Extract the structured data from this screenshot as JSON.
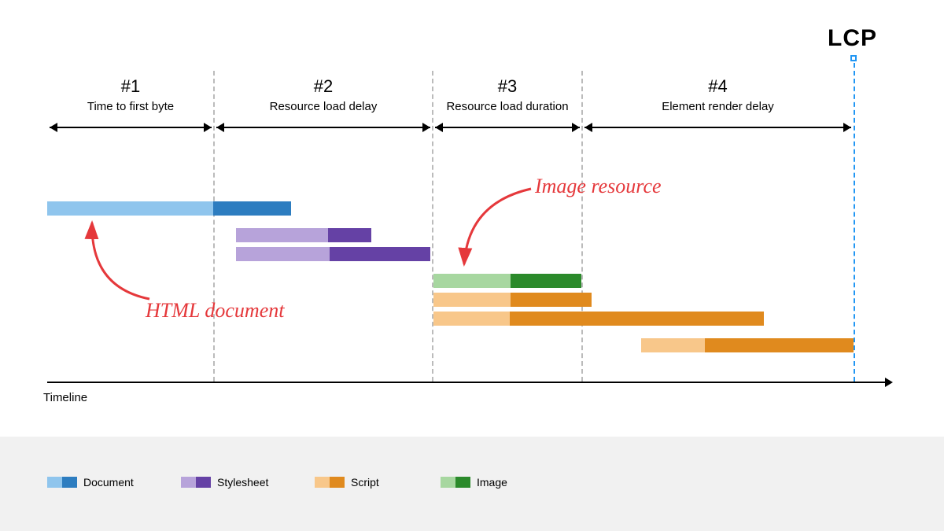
{
  "lcp_label": "LCP",
  "phases": [
    {
      "num": "#1",
      "title": "Time to first byte"
    },
    {
      "num": "#2",
      "title": "Resource load delay"
    },
    {
      "num": "#3",
      "title": "Resource load duration"
    },
    {
      "num": "#4",
      "title": "Element render delay"
    }
  ],
  "axis_label": "Timeline",
  "annotations": {
    "html_doc": "HTML document",
    "image_res": "Image resource"
  },
  "legend": [
    {
      "label": "Document",
      "light": "#8fc5ed",
      "dark": "#2d7dc0"
    },
    {
      "label": "Stylesheet",
      "light": "#b7a3da",
      "dark": "#6541a5"
    },
    {
      "label": "Script",
      "light": "#f8c78a",
      "dark": "#e08a1e"
    },
    {
      "label": "Image",
      "light": "#a7d7a0",
      "dark": "#2b8a2b"
    }
  ],
  "chart_data": {
    "type": "gantt",
    "title": "LCP phase breakdown waterfall",
    "xlabel": "Timeline",
    "xlim": [
      0,
      100
    ],
    "phases": [
      {
        "name": "Time to first byte",
        "start": 0,
        "end": 19
      },
      {
        "name": "Resource load delay",
        "start": 19,
        "end": 45
      },
      {
        "name": "Resource load duration",
        "start": 45,
        "end": 62
      },
      {
        "name": "Element render delay",
        "start": 62,
        "end": 100
      }
    ],
    "lcp_at": 100,
    "bars": [
      {
        "type": "Document",
        "start": 0,
        "light_end": 19,
        "dark_end": 27
      },
      {
        "type": "Stylesheet",
        "start": 22,
        "light_end": 34,
        "dark_end": 40
      },
      {
        "type": "Stylesheet",
        "start": 22,
        "light_end": 34,
        "dark_end": 45
      },
      {
        "type": "Image",
        "start": 45,
        "light_end": 54,
        "dark_end": 62
      },
      {
        "type": "Script",
        "start": 45,
        "light_end": 54,
        "dark_end": 63
      },
      {
        "type": "Script",
        "start": 45,
        "light_end": 54,
        "dark_end": 84
      },
      {
        "type": "Script",
        "start": 70,
        "light_end": 80,
        "dark_end": 100
      }
    ]
  }
}
